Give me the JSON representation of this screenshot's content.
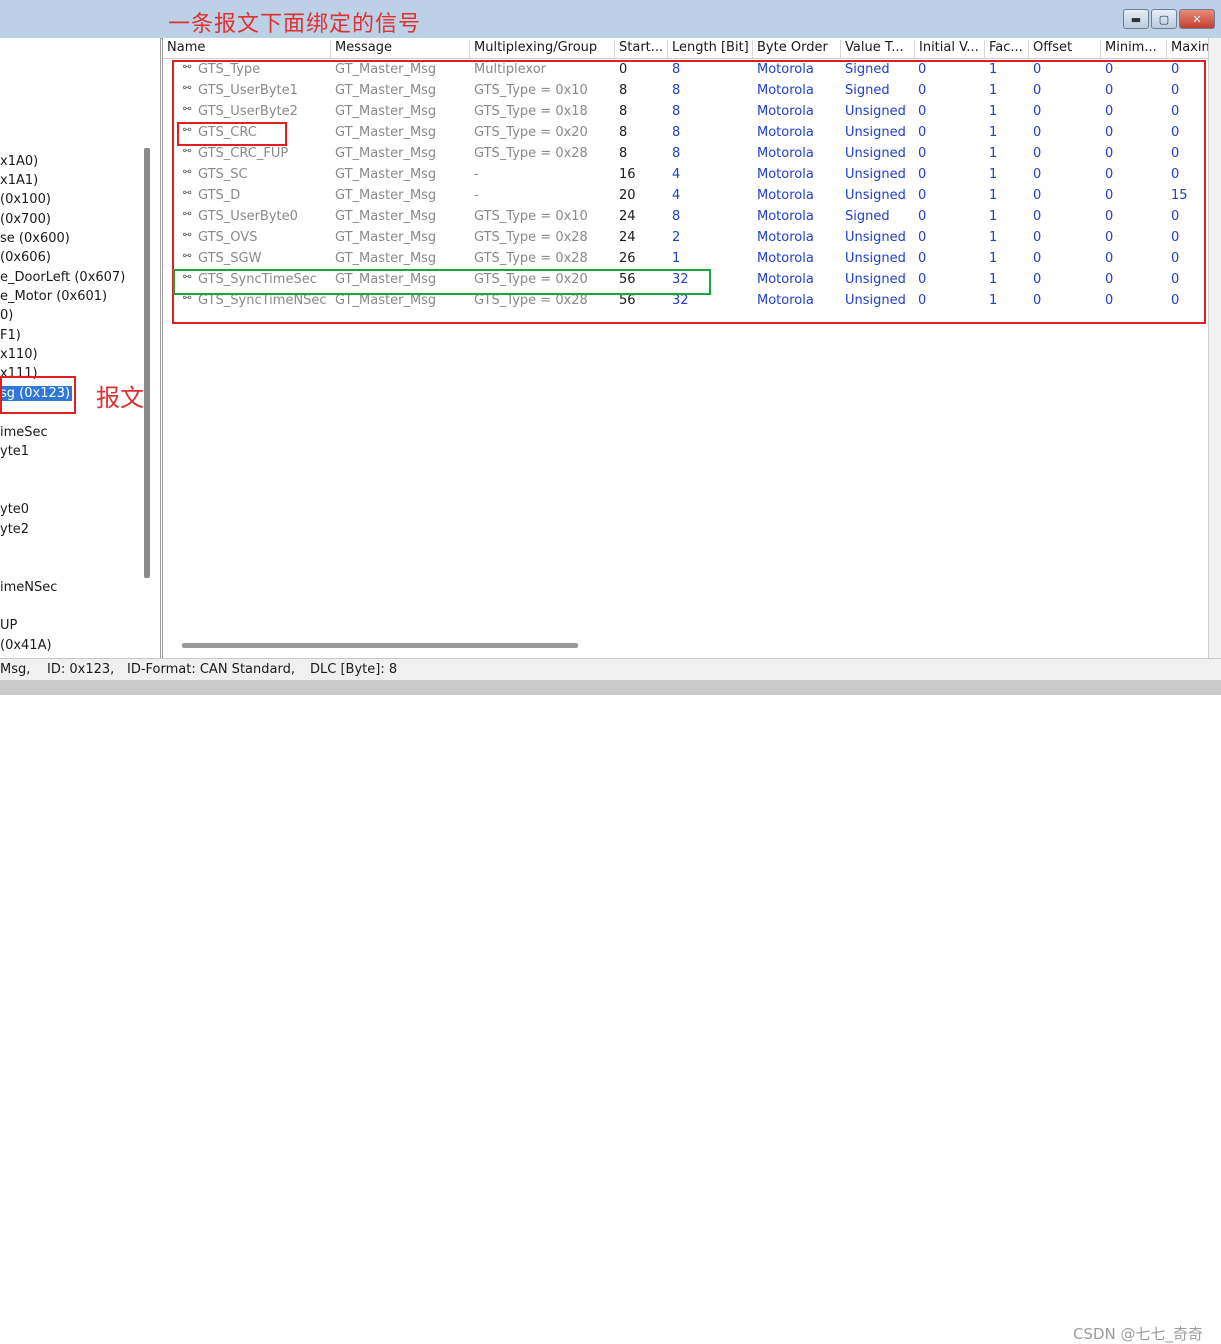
{
  "annotations": {
    "title": "一条报文下面绑定的信号",
    "message_label": "报文"
  },
  "window_buttons": {
    "minimize": "▬",
    "maximize": "▢",
    "close": "✕"
  },
  "tree": {
    "items": [
      {
        "label": "x1A0)"
      },
      {
        "label": "x1A1)"
      },
      {
        "label": "(0x100)"
      },
      {
        "label": "(0x700)"
      },
      {
        "label": "se (0x600)"
      },
      {
        "label": "(0x606)"
      },
      {
        "label": "e_DoorLeft (0x607)"
      },
      {
        "label": "e_Motor (0x601)"
      },
      {
        "label": "0)"
      },
      {
        "label": "F1)"
      },
      {
        "label": "x110)"
      },
      {
        "label": "x111)"
      },
      {
        "label": "sg (0x123)"
      },
      {
        "label": "imeSec"
      },
      {
        "label": "yte1"
      },
      {
        "label": "yte0"
      },
      {
        "label": "yte2"
      },
      {
        "label": "imeNSec"
      },
      {
        "label": "UP"
      },
      {
        "label": "(0x41A)"
      }
    ]
  },
  "table": {
    "headers": [
      "Name",
      "Message",
      "Multiplexing/Group",
      "Start...",
      "Length [Bit]",
      "Byte Order",
      "Value T...",
      "Initial V...",
      "Fac...",
      "Offset",
      "Minim...",
      "Maxin"
    ],
    "rows": [
      {
        "name": "GTS_Type",
        "message": "GT_Master_Msg",
        "mux": "Multiplexor",
        "start": "0",
        "length": "8",
        "order": "Motorola",
        "vtype": "Signed",
        "initial": "0",
        "factor": "1",
        "offset": "0",
        "min": "0",
        "max": "0"
      },
      {
        "name": "GTS_UserByte1",
        "message": "GT_Master_Msg",
        "mux": "GTS_Type = 0x10",
        "start": "8",
        "length": "8",
        "order": "Motorola",
        "vtype": "Signed",
        "initial": "0",
        "factor": "1",
        "offset": "0",
        "min": "0",
        "max": "0"
      },
      {
        "name": "GTS_UserByte2",
        "message": "GT_Master_Msg",
        "mux": "GTS_Type = 0x18",
        "start": "8",
        "length": "8",
        "order": "Motorola",
        "vtype": "Unsigned",
        "initial": "0",
        "factor": "1",
        "offset": "0",
        "min": "0",
        "max": "0"
      },
      {
        "name": "GTS_CRC",
        "message": "GT_Master_Msg",
        "mux": "GTS_Type = 0x20",
        "start": "8",
        "length": "8",
        "order": "Motorola",
        "vtype": "Unsigned",
        "initial": "0",
        "factor": "1",
        "offset": "0",
        "min": "0",
        "max": "0"
      },
      {
        "name": "GTS_CRC_FUP",
        "message": "GT_Master_Msg",
        "mux": "GTS_Type = 0x28",
        "start": "8",
        "length": "8",
        "order": "Motorola",
        "vtype": "Unsigned",
        "initial": "0",
        "factor": "1",
        "offset": "0",
        "min": "0",
        "max": "0"
      },
      {
        "name": "GTS_SC",
        "message": "GT_Master_Msg",
        "mux": "-",
        "start": "16",
        "length": "4",
        "order": "Motorola",
        "vtype": "Unsigned",
        "initial": "0",
        "factor": "1",
        "offset": "0",
        "min": "0",
        "max": "0"
      },
      {
        "name": "GTS_D",
        "message": "GT_Master_Msg",
        "mux": "-",
        "start": "20",
        "length": "4",
        "order": "Motorola",
        "vtype": "Unsigned",
        "initial": "0",
        "factor": "1",
        "offset": "0",
        "min": "0",
        "max": "15"
      },
      {
        "name": "GTS_UserByte0",
        "message": "GT_Master_Msg",
        "mux": "GTS_Type = 0x10",
        "start": "24",
        "length": "8",
        "order": "Motorola",
        "vtype": "Signed",
        "initial": "0",
        "factor": "1",
        "offset": "0",
        "min": "0",
        "max": "0"
      },
      {
        "name": "GTS_OVS",
        "message": "GT_Master_Msg",
        "mux": "GTS_Type = 0x28",
        "start": "24",
        "length": "2",
        "order": "Motorola",
        "vtype": "Unsigned",
        "initial": "0",
        "factor": "1",
        "offset": "0",
        "min": "0",
        "max": "0"
      },
      {
        "name": "GTS_SGW",
        "message": "GT_Master_Msg",
        "mux": "GTS_Type = 0x28",
        "start": "26",
        "length": "1",
        "order": "Motorola",
        "vtype": "Unsigned",
        "initial": "0",
        "factor": "1",
        "offset": "0",
        "min": "0",
        "max": "0"
      },
      {
        "name": "GTS_SyncTimeSec",
        "message": "GT_Master_Msg",
        "mux": "GTS_Type = 0x20",
        "start": "56",
        "length": "32",
        "order": "Motorola",
        "vtype": "Unsigned",
        "initial": "0",
        "factor": "1",
        "offset": "0",
        "min": "0",
        "max": "0"
      },
      {
        "name": "GTS_SyncTimeNSec",
        "message": "GT_Master_Msg",
        "mux": "GTS_Type = 0x28",
        "start": "56",
        "length": "32",
        "order": "Motorola",
        "vtype": "Unsigned",
        "initial": "0",
        "factor": "1",
        "offset": "0",
        "min": "0",
        "max": "0"
      }
    ]
  },
  "status": {
    "name": "Msg,",
    "id": "ID: 0x123,",
    "format": "ID-Format: CAN Standard,",
    "dlc": "DLC [Byte]: 8"
  },
  "watermark": "CSDN @七七_奇奇"
}
